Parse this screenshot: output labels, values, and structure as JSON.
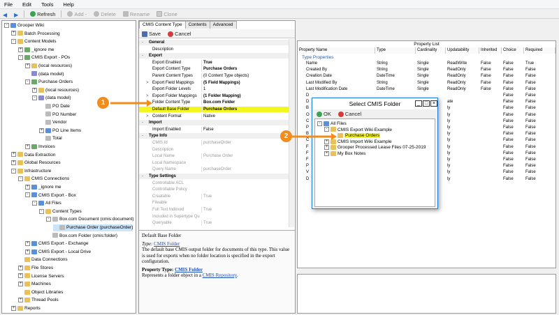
{
  "menu": [
    "File",
    "Edit",
    "Tools",
    "Help"
  ],
  "toolbar": {
    "refresh": "Refresh",
    "add": "Add -",
    "delete": "Delete",
    "rename": "Rename",
    "clone": "Clone"
  },
  "tree": [
    {
      "label": "Grooper Wiki",
      "indent": 0,
      "exp": "-",
      "color": "#5b8fd6"
    },
    {
      "label": "Batch Processing",
      "indent": 1,
      "exp": "+",
      "color": "#e8c15c"
    },
    {
      "label": "Content Models",
      "indent": 1,
      "exp": "-",
      "color": "#e8c15c"
    },
    {
      "label": "_ignore me",
      "indent": 2,
      "exp": "+",
      "color": "#6aa96a"
    },
    {
      "label": "CMIS Export - POs",
      "indent": 2,
      "exp": "-",
      "color": "#6aa96a"
    },
    {
      "label": "(local resources)",
      "indent": 3,
      "exp": "+",
      "color": "#e8c15c"
    },
    {
      "label": "(data model)",
      "indent": 3,
      "exp": "",
      "color": "#8a8ad0"
    },
    {
      "label": "Purchase Orders",
      "indent": 3,
      "exp": "-",
      "color": "#6aa96a"
    },
    {
      "label": "(local resources)",
      "indent": 4,
      "exp": "+",
      "color": "#e8c15c"
    },
    {
      "label": "(data model)",
      "indent": 4,
      "exp": "-",
      "color": "#8a8ad0"
    },
    {
      "label": "PO Date",
      "indent": 5,
      "exp": "",
      "color": "#bbbbbb"
    },
    {
      "label": "PO Number",
      "indent": 5,
      "exp": "",
      "color": "#bbbbbb"
    },
    {
      "label": "Vendor",
      "indent": 5,
      "exp": "",
      "color": "#bbbbbb"
    },
    {
      "label": "PO Line Items",
      "indent": 5,
      "exp": "+",
      "color": "#5b8fd6"
    },
    {
      "label": "Total",
      "indent": 5,
      "exp": "",
      "color": "#bbbbbb"
    },
    {
      "label": "Invoices",
      "indent": 3,
      "exp": "+",
      "color": "#6aa96a"
    },
    {
      "label": "Data Extraction",
      "indent": 1,
      "exp": "+",
      "color": "#e8c15c"
    },
    {
      "label": "Global Resources",
      "indent": 1,
      "exp": "+",
      "color": "#e8c15c"
    },
    {
      "label": "Infrastructure",
      "indent": 1,
      "exp": "-",
      "color": "#e8c15c"
    },
    {
      "label": "CMIS Connections",
      "indent": 2,
      "exp": "-",
      "color": "#e8c15c"
    },
    {
      "label": "_ignore me",
      "indent": 3,
      "exp": "+",
      "color": "#5b8fd6"
    },
    {
      "label": "CMIS Export - Box",
      "indent": 3,
      "exp": "-",
      "color": "#5b8fd6"
    },
    {
      "label": "All Files",
      "indent": 4,
      "exp": "-",
      "color": "#5b8fd6"
    },
    {
      "label": "Content Types",
      "indent": 5,
      "exp": "-",
      "color": "#e8c15c"
    },
    {
      "label": "Box.com Document (cmis:document)",
      "indent": 6,
      "exp": "-",
      "color": "#bbbbbb"
    },
    {
      "label": "Purchase Order (purchaseOrder)",
      "indent": 7,
      "exp": "",
      "color": "#bbbbbb",
      "selected": true
    },
    {
      "label": "Box.com Folder (cmis:folder)",
      "indent": 6,
      "exp": "",
      "color": "#bbbbbb"
    },
    {
      "label": "CMIS Export - Exchange",
      "indent": 3,
      "exp": "+",
      "color": "#5b8fd6"
    },
    {
      "label": "CMIS Export - Local Drive",
      "indent": 3,
      "exp": "+",
      "color": "#5b8fd6"
    },
    {
      "label": "Data Connections",
      "indent": 2,
      "exp": "",
      "color": "#e8c15c"
    },
    {
      "label": "File Stores",
      "indent": 2,
      "exp": "+",
      "color": "#e8c15c"
    },
    {
      "label": "License Servers",
      "indent": 2,
      "exp": "+",
      "color": "#e8c15c"
    },
    {
      "label": "Machines",
      "indent": 2,
      "exp": "+",
      "color": "#e8c15c"
    },
    {
      "label": "Object Libraries",
      "indent": 2,
      "exp": "",
      "color": "#e8c15c"
    },
    {
      "label": "Thread Pools",
      "indent": 2,
      "exp": "+",
      "color": "#e8c15c"
    },
    {
      "label": "Reports",
      "indent": 1,
      "exp": "+",
      "color": "#e8c15c"
    }
  ],
  "tabs": [
    "CMIS Content Type",
    "Contents",
    "Advanced"
  ],
  "actions": {
    "save": "Save",
    "cancel": "Cancel"
  },
  "props": [
    {
      "n": "General",
      "v": "",
      "cat": true,
      "exp": "-"
    },
    {
      "n": "Description",
      "v": ""
    },
    {
      "n": "Export",
      "v": "",
      "cat": true,
      "exp": "-"
    },
    {
      "n": "Export Enabled",
      "v": "True",
      "bold": true
    },
    {
      "n": "Export Content Type",
      "v": "Purchase Orders",
      "bold": true
    },
    {
      "n": "Parent Content Types",
      "v": "(0 Content Type objects)"
    },
    {
      "n": "Export Field Mappings",
      "v": "(5 Field Mappings)",
      "bold": true,
      "exp": ">"
    },
    {
      "n": "Export Folder Levels",
      "v": "1"
    },
    {
      "n": "Export Folder Mappings",
      "v": "(1 Folder Mapping)",
      "bold": true,
      "exp": ">"
    },
    {
      "n": "Folder Content Type",
      "v": "Box.com Folder",
      "bold": true
    },
    {
      "n": "Default Base Folder",
      "v": "Purchase Orders",
      "bold": true,
      "hl": true
    },
    {
      "n": "Content Format",
      "v": "Native",
      "exp": ">"
    },
    {
      "n": "Import",
      "v": "",
      "cat": true,
      "exp": "-"
    },
    {
      "n": "Import Enabled",
      "v": "False"
    },
    {
      "n": "Type Info",
      "v": "",
      "cat": true,
      "exp": "-"
    },
    {
      "n": "CMIS Id",
      "v": "purchaseOrder",
      "grey": true
    },
    {
      "n": "Description",
      "v": "",
      "grey": true
    },
    {
      "n": "Local Name",
      "v": "Purchase Order",
      "grey": true
    },
    {
      "n": "Local Namespace",
      "v": "",
      "grey": true
    },
    {
      "n": "Query Name",
      "v": "purchaseOrder",
      "grey": true
    },
    {
      "n": "Type Settings",
      "v": "",
      "cat": true,
      "exp": "-"
    },
    {
      "n": "Controllable ACL",
      "v": "",
      "grey": true
    },
    {
      "n": "Controllable Policy",
      "v": "",
      "grey": true
    },
    {
      "n": "Creatable",
      "v": "True",
      "grey": true
    },
    {
      "n": "Fileable",
      "v": "",
      "grey": true
    },
    {
      "n": "Full Text Indexed",
      "v": "True",
      "grey": true
    },
    {
      "n": "Included in Supertype Que",
      "v": "",
      "grey": true
    },
    {
      "n": "Queryable",
      "v": "True",
      "grey": true
    }
  ],
  "help": {
    "title": "Default Base Folder",
    "type_label": "Type:",
    "type_link": "CMIS Folder",
    "desc": "The default base CMIS output folder for documents of this type. This value is used for exports when no folder location is specified in the export configuration.",
    "prop_type_label": "Property Type:",
    "prop_type_link": "CMIS Folder",
    "repr": "Represents a folder object in a",
    "repr_link": "CMIS Repository",
    "repr_end": "."
  },
  "property_list": {
    "title": "Property List",
    "columns": [
      "Property Name",
      "Type",
      "Cardinality",
      "Updatability",
      "Inherited",
      "Choice",
      "Required"
    ],
    "group": "Type Properties",
    "rows": [
      [
        "Name",
        "String",
        "Single",
        "ReadWrite",
        "False",
        "False",
        "True"
      ],
      [
        "Created By",
        "String",
        "Single",
        "ReadOnly",
        "False",
        "False",
        "False"
      ],
      [
        "Creation Date",
        "DateTime",
        "Single",
        "ReadOnly",
        "False",
        "False",
        "False"
      ],
      [
        "Last Modified By",
        "String",
        "Single",
        "ReadOnly",
        "False",
        "False",
        "False"
      ],
      [
        "Last Modification Date",
        "DateTime",
        "Single",
        "ReadOnly",
        "False",
        "False",
        "False"
      ],
      [
        "D",
        "",
        "",
        "",
        "",
        "False",
        "False"
      ],
      [
        "D",
        "",
        "",
        "ate",
        "",
        "False",
        "False"
      ],
      [
        "B",
        "",
        "",
        "ly",
        "",
        "False",
        "False"
      ],
      [
        "O",
        "",
        "",
        "ly",
        "",
        "False",
        "False"
      ],
      [
        "C",
        "",
        "",
        "ly",
        "",
        "False",
        "False"
      ],
      [
        "P",
        "",
        "",
        "ly",
        "",
        "False",
        "False"
      ],
      [
        "B",
        "",
        "",
        "ly",
        "",
        "False",
        "False"
      ],
      [
        "C",
        "",
        "",
        "ly",
        "",
        "False",
        "False"
      ],
      [
        "F",
        "",
        "",
        "ly",
        "",
        "False",
        "False"
      ],
      [
        "F",
        "",
        "",
        "ly",
        "",
        "False",
        "False"
      ],
      [
        "F",
        "",
        "",
        "ly",
        "",
        "False",
        "False"
      ],
      [
        "P",
        "",
        "",
        "ly",
        "",
        "False",
        "False"
      ],
      [
        "V",
        "",
        "",
        "ly",
        "",
        "False",
        "False"
      ],
      [
        "D",
        "",
        "",
        "ly",
        "",
        "False",
        "False"
      ]
    ]
  },
  "dialog": {
    "title": "Select CMIS Folder",
    "ok": "OK",
    "cancel": "Cancel",
    "tree": [
      {
        "label": "All Files",
        "indent": 0,
        "exp": "-"
      },
      {
        "label": "CMIS Export Wiki Example",
        "indent": 1,
        "exp": "-"
      },
      {
        "label": "Purchase Orders",
        "indent": 2,
        "exp": "",
        "hl": true
      },
      {
        "label": "CMIS Import Wiki Example",
        "indent": 1,
        "exp": "+"
      },
      {
        "label": "Grooper Processed Lease Files 07-25-2019",
        "indent": 1,
        "exp": "+"
      },
      {
        "label": "My Box Notes",
        "indent": 1,
        "exp": "+"
      }
    ]
  },
  "callouts": [
    "1",
    "2"
  ],
  "colors": {
    "highlight": "#f5f51f",
    "callout": "#f28c1a",
    "arrow": "#f28c1a",
    "selected": "#cce4f7",
    "link": "#1a4fb5"
  }
}
